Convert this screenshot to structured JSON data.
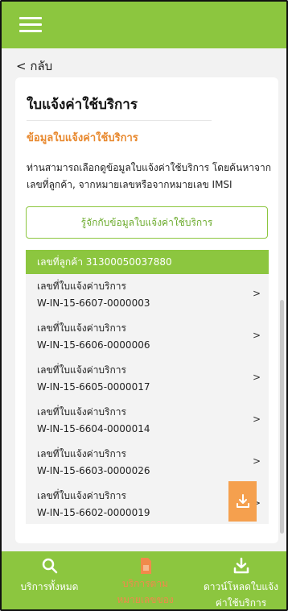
{
  "header": {
    "menu_icon": "hamburger-menu-icon"
  },
  "back": {
    "label": "< กลับ"
  },
  "card": {
    "title": "ใบแจ้งค่าใช้บริการ",
    "section_title": "ข้อมูลใบแจ้งค่าใช้บริการ",
    "description": "ท่านสามารถเลือกดูข้อมูลใบแจ้งค่าใช้บริการ โดยค้นหาจากเลขที่ลูกค้า, จากหมายเลขหรือจากหมายเลข IMSI",
    "info_button_label": "รู้จักกับข้อมูลใบแจ้งค่าใช้บริการ"
  },
  "invoice_list": {
    "header": "เลขที่ลูกค้า 31300050037880",
    "items": [
      {
        "label": "เลขที่ใบแจ้งค่าบริการ",
        "number": "W-IN-15-6607-0000003",
        "chevron": ">"
      },
      {
        "label": "เลขที่ใบแจ้งค่าบริการ",
        "number": "W-IN-15-6606-0000006",
        "chevron": ">"
      },
      {
        "label": "เลขที่ใบแจ้งค่าบริการ",
        "number": "W-IN-15-6605-0000017",
        "chevron": ">"
      },
      {
        "label": "เลขที่ใบแจ้งค่าบริการ",
        "number": "W-IN-15-6604-0000014",
        "chevron": ">"
      },
      {
        "label": "เลขที่ใบแจ้งค่าบริการ",
        "number": "W-IN-15-6603-0000026",
        "chevron": ">"
      },
      {
        "label": "เลขที่ใบแจ้งค่าบริการ",
        "number": "W-IN-15-6602-0000019",
        "chevron": ">"
      }
    ]
  },
  "download_fab": {
    "icon": "download-icon"
  },
  "bottom_nav": {
    "items": [
      {
        "label": "บริการทั้งหมด",
        "icon": "search-icon",
        "active": false
      },
      {
        "label_line1": "บริการตามหมายเลขของท่าน",
        "icon": "sim-icon",
        "active": true
      },
      {
        "label_line1": "ดาวน์โหลดใบแจ้ง",
        "label_line2": "ค่าใช้บริการ",
        "icon": "download-icon",
        "active": false
      }
    ]
  },
  "colors": {
    "brand_green": "#8cc63f",
    "accent_orange": "#e8892f",
    "active_nav": "#f08a4b"
  }
}
